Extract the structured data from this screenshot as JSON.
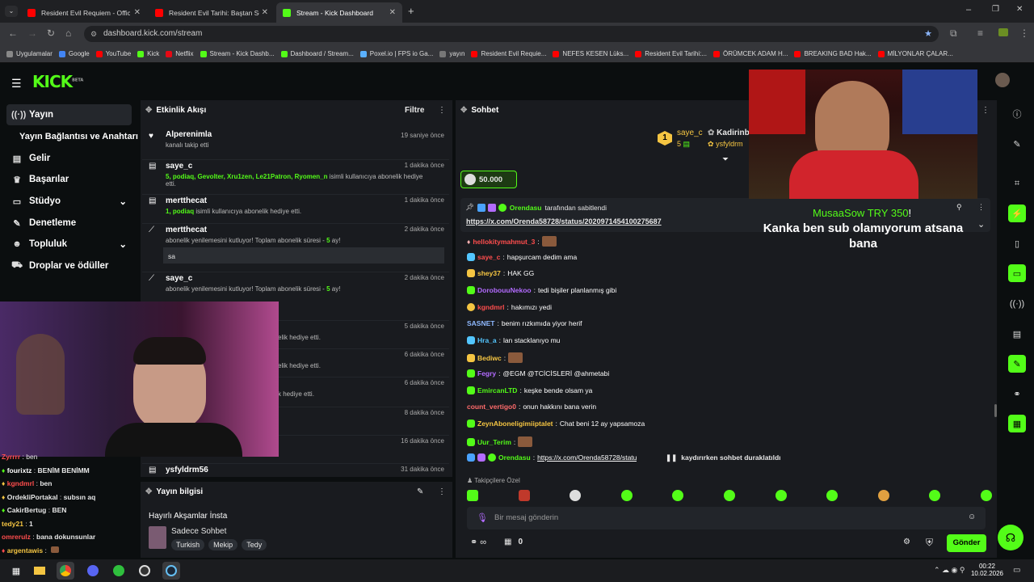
{
  "browser": {
    "tabs": [
      {
        "title": "Resident Evil Requiem - Official",
        "color": "#ff0000"
      },
      {
        "title": "Resident Evil Tarihi: Baştan Sona",
        "color": "#ff0000"
      },
      {
        "title": "Stream - Kick Dashboard",
        "color": "#53fc18"
      }
    ],
    "url": "dashboard.kick.com/stream",
    "bookmarks": [
      "Uygulamalar",
      "Google",
      "YouTube",
      "Kick",
      "Netflix",
      "Stream - Kick Dashb...",
      "Dashboard / Stream...",
      "Poxel.io | FPS io Ga...",
      "yayın",
      "Resident Evil Requie...",
      "NEFES KESEN Lüks...",
      "Resident Evil Tarihi:...",
      "ÖRÜMCEK ADAM H...",
      "BREAKING BAD Hak...",
      "MİLYONLAR ÇALAR..."
    ]
  },
  "brand": {
    "logo": "KICK",
    "beta": "BETA",
    "accent": "#53fc18"
  },
  "sidebar": {
    "items": [
      {
        "label": "Yayın",
        "icon": "broadcast-icon"
      },
      {
        "label": "Yayın Bağlantısı ve Anahtarı"
      },
      {
        "label": "Gelir",
        "icon": "income-icon"
      },
      {
        "label": "Başarılar",
        "icon": "trophy-icon"
      },
      {
        "label": "Stüdyo",
        "icon": "studio-icon"
      },
      {
        "label": "Denetleme",
        "icon": "wrench-icon"
      },
      {
        "label": "Topluluk",
        "icon": "community-icon"
      },
      {
        "label": "Droplar ve ödüller",
        "icon": "drops-icon"
      }
    ]
  },
  "activity": {
    "title": "Etkinlik Akışı",
    "filter": "Filtre",
    "items": [
      {
        "name": "Alperenimla",
        "time": "19 saniye önce",
        "desc": "kanalı takip etti"
      },
      {
        "name": "saye_c",
        "time": "1 dakika önce",
        "gifted": "5, podiaq, Gevolter, Xru1zen, Le21Patron, Ryomen_n",
        "desc": " isimli kullanıcıya abonelik hediye etti."
      },
      {
        "name": "mertthecat",
        "time": "1 dakika önce",
        "gifted": "1, podiaq",
        "desc": " isimli kullanıcıya abonelik hediye etti."
      },
      {
        "name": "mertthecat",
        "time": "2 dakika önce",
        "desc_a": "abonelik yenilemesini kutluyor! Toplam abonelik süresi - ",
        "months": "5",
        "desc_b": " ay!",
        "message": "sa"
      },
      {
        "name": "saye_c",
        "time": "2 dakika önce",
        "desc_a": "abonelik yenilemesini kutluyor! Toplam abonelik süresi - ",
        "months": "5",
        "desc_b": " ay!"
      },
      {
        "time": "5 dakika önce",
        "desc": "elik hediye etti."
      },
      {
        "time": "6 dakika önce",
        "desc": "elik hediye etti."
      },
      {
        "time": "6 dakika önce",
        "desc": "k hediye etti."
      },
      {
        "time": "8 dakika önce"
      },
      {
        "time": "16 dakika önce"
      },
      {
        "name": "ysfyldrm56",
        "time": "31 dakika önce"
      }
    ]
  },
  "stream_info": {
    "title": "Yayın bilgisi",
    "stream_title": "Hayırlı Akşamlar İnsta",
    "category": "Sadece Sohbet",
    "tags": [
      "Turkish",
      "Mekip",
      "Tedy"
    ]
  },
  "chat": {
    "title": "Sohbet",
    "top_gifters": [
      {
        "name": "saye_c",
        "count": "5",
        "rank": "1"
      },
      {
        "name": "Kadirinb",
        "sub": "ysfyldrm"
      }
    ],
    "goal": "50.000",
    "pinned": {
      "by": "Orendasu",
      "label": "tarafından sabitlendi",
      "link": "https://x.com/Orenda58728/status/2020971454100275687"
    },
    "messages": [
      {
        "user": "hellokitymahmut_3",
        "text": "",
        "color": "#ff4d4d",
        "emote": true
      },
      {
        "user": "saye_c",
        "text": "hapşurcam dedim ama",
        "color": "#ff4d4d"
      },
      {
        "user": "shey37",
        "text": "HAK GG",
        "color": "#f5c542"
      },
      {
        "user": "DorobouuNekoo",
        "text": "tedi bişiler planlanmış gibi",
        "color": "#b36bff"
      },
      {
        "user": "kgndmrl",
        "text": "hakımızı yedi",
        "color": "#ff4d4d"
      },
      {
        "user": "SASNET",
        "text": "benim rızkımıda yiyor herif",
        "color": "#8fb9ff"
      },
      {
        "user": "Hra_a",
        "text": "lan stacklanıyo mu",
        "color": "#53c6ff"
      },
      {
        "user": "Bediwc",
        "text": "",
        "color": "#f5c542",
        "emote": true
      },
      {
        "user": "Fegry",
        "text": "@EGM @TCİCİSLERİ @ahmetabi",
        "color": "#b36bff"
      },
      {
        "user": "EmircanLTD",
        "text": "keşke bende olsam ya",
        "color": "#53fc18"
      },
      {
        "user": "count_vertigo0",
        "text": "onun hakkını bana verin",
        "color": "#ff6b6b"
      },
      {
        "user": "ZeynAboneligimiiptalet",
        "text": "Chat beni 12 ay yapsamoza",
        "color": "#f5c542"
      },
      {
        "user": "Uur_Terim",
        "text": "",
        "color": "#53fc18",
        "emote": true
      },
      {
        "user": "Orendasu",
        "text": "https://x.com/Orenda58728/statu",
        "color": "#53fc18"
      }
    ],
    "paused": "kaydırırken sohbet duraklatıldı",
    "followers_only": "Takipçilere Özel",
    "input_placeholder": "Bir mesaj gönderin",
    "kicks": "0",
    "send": "Gönder"
  },
  "overlay": {
    "alert_user": "MusaaSow",
    "alert_amount": "TRY 350",
    "alert_bang": "!",
    "alert_message": "Kanka ben sub olamıyorum atsana bana"
  },
  "left_chat": [
    {
      "user": "Zyrrrr",
      "text": "ben",
      "color": "#ff4d4d"
    },
    {
      "user": "fourixtz",
      "text": "BENİM BENİMM",
      "color": "#53fc18"
    },
    {
      "user": "kgndmrl",
      "text": "ben",
      "color": "#ff4d4d"
    },
    {
      "user": "OrdekliPortakal",
      "text": "subsın aq",
      "color": "#f5c542"
    },
    {
      "user": "CakirBertug",
      "text": "BEN",
      "color": "#53fc18"
    },
    {
      "user": "tedy21",
      "text": "1",
      "color": "#f5c542"
    },
    {
      "user": "omrerulz",
      "text": "bana dokunsunlar",
      "color": "#ff4d4d"
    },
    {
      "user": "argentawis",
      "text": "",
      "color": "#f5c542"
    }
  ],
  "taskbar": {
    "time": "00:22",
    "date": "10.02.2026"
  }
}
